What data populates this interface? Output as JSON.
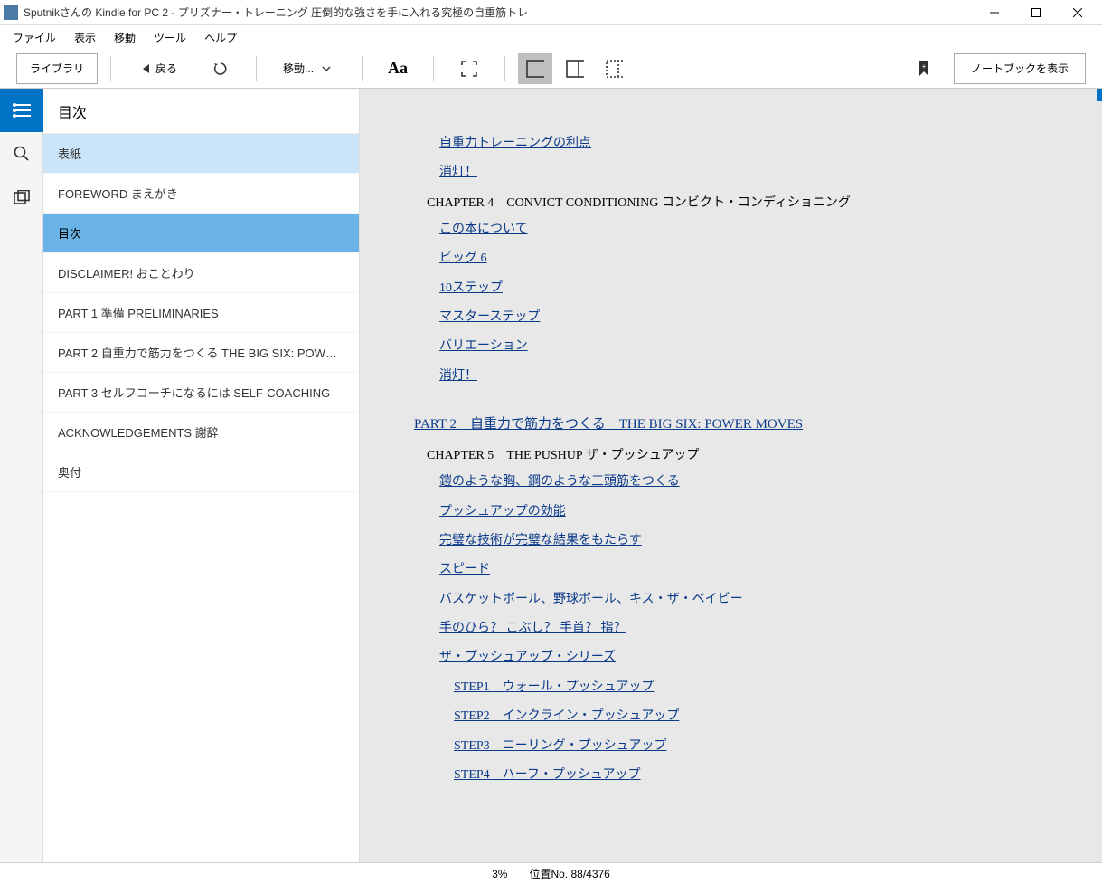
{
  "window": {
    "title": "Sputnikさんの Kindle for PC 2 - プリズナー・トレーニング 圧倒的な強さを手に入れる究極の自重筋トレ"
  },
  "menubar": {
    "file": "ファイル",
    "view": "表示",
    "go": "移動",
    "tools": "ツール",
    "help": "ヘルプ"
  },
  "toolbar": {
    "library": "ライブラリ",
    "back": "戻る",
    "goto": "移動...",
    "notebook": "ノートブックを表示"
  },
  "sidebar": {
    "header": "目次",
    "items": [
      {
        "label": "表紙"
      },
      {
        "label": "FOREWORD まえがき"
      },
      {
        "label": "目次"
      },
      {
        "label": "DISCLAIMER! おことわり"
      },
      {
        "label": "PART 1   準備   PRELIMINARIES"
      },
      {
        "label": "PART 2   自重力で筋力をつくる   THE BIG SIX: POWER M..."
      },
      {
        "label": "PART 3   セルフコーチになるには   SELF-COACHING"
      },
      {
        "label": "ACKNOWLEDGEMENTS 謝辞"
      },
      {
        "label": "奥付"
      }
    ]
  },
  "content": {
    "links_a": [
      {
        "text": "自重力トレーニングの利点"
      },
      {
        "text": "消灯！"
      }
    ],
    "chapter4": "CHAPTER 4　CONVICT CONDITIONING コンビクト・コンディショニング",
    "links_b": [
      {
        "text": "この本について"
      },
      {
        "text": "ビッグ 6"
      },
      {
        "text": "10ステップ"
      },
      {
        "text": "マスターステップ"
      },
      {
        "text": "バリエーション"
      },
      {
        "text": "消灯！"
      }
    ],
    "part2": "PART 2　自重力で筋力をつくる　THE BIG SIX: POWER MOVES",
    "chapter5": "CHAPTER 5　THE PUSHUP ザ・プッシュアップ",
    "links_c": [
      {
        "text": "鎧のような胸、鋼のような三頭筋をつくる"
      },
      {
        "text": "プッシュアップの効能"
      },
      {
        "text": "完璧な技術が完璧な結果をもたらす"
      },
      {
        "text": "スピード"
      },
      {
        "text": "バスケットボール、野球ボール、キス・ザ・ベイビー"
      },
      {
        "text": "手のひら？ こぶし？ 手首？ 指？"
      },
      {
        "text": "ザ・プッシュアップ・シリーズ"
      }
    ],
    "steps": [
      {
        "text": "STEP1　ウォール・プッシュアップ"
      },
      {
        "text": "STEP2　インクライン・プッシュアップ"
      },
      {
        "text": "STEP3　ニーリング・プッシュアップ"
      },
      {
        "text": "STEP4　ハーフ・プッシュアップ"
      }
    ]
  },
  "status": {
    "percent": "3%",
    "position": "位置No. 88/4376"
  }
}
